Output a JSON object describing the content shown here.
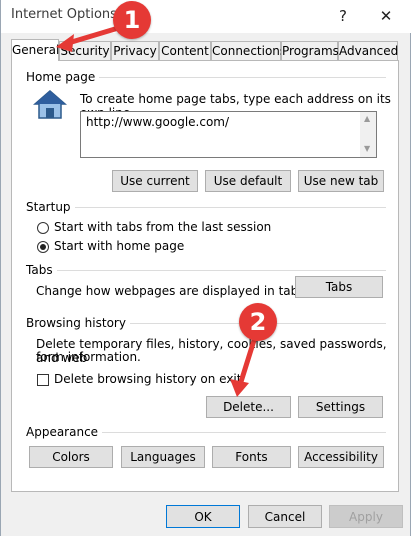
{
  "window": {
    "title": "Internet Options",
    "help_glyph": "?",
    "close_glyph": "✕"
  },
  "tabs": [
    "General",
    "Security",
    "Privacy",
    "Content",
    "Connections",
    "Programs",
    "Advanced"
  ],
  "home_page": {
    "section_title": "Home page",
    "instruction": "To create home page tabs, type each address on its own line.",
    "url": "http://www.google.com/",
    "buttons": {
      "use_current": "Use current",
      "use_default": "Use default",
      "use_new_tab": "Use new tab"
    }
  },
  "startup": {
    "section_title": "Startup",
    "option_last_session": "Start with tabs from the last session",
    "option_home_page": "Start with home page",
    "selected": "home_page"
  },
  "tabs_section": {
    "section_title": "Tabs",
    "description": "Change how webpages are displayed in tabs.",
    "button": "Tabs"
  },
  "browsing_history": {
    "section_title": "Browsing history",
    "description_line1": "Delete temporary files, history, cookies, saved passwords, and web",
    "description_line2": "form information.",
    "checkbox_label": "Delete browsing history on exit",
    "checkbox_checked": false,
    "delete_button": "Delete...",
    "settings_button": "Settings"
  },
  "appearance": {
    "section_title": "Appearance",
    "buttons": {
      "colors": "Colors",
      "languages": "Languages",
      "fonts": "Fonts",
      "accessibility": "Accessibility"
    }
  },
  "footer": {
    "ok": "OK",
    "cancel": "Cancel",
    "apply": "Apply"
  },
  "annotations": {
    "badge1": "1",
    "badge2": "2",
    "color": "#e53935"
  }
}
